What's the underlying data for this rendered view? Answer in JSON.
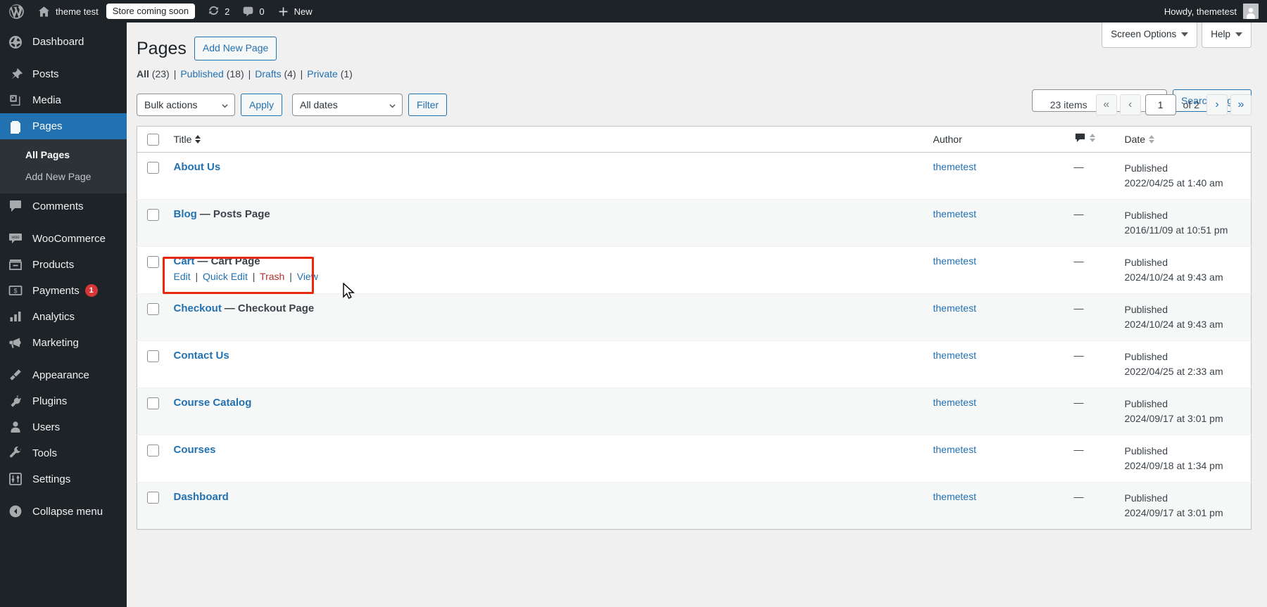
{
  "adminbar": {
    "wp_logo": "wordpress-logo-icon",
    "site_name": "theme test",
    "coming_soon": "Store coming soon",
    "updates_count": "2",
    "comments_count": "0",
    "new_label": "New",
    "howdy": "Howdy, themetest"
  },
  "sidebar": {
    "items": [
      {
        "label": "Dashboard",
        "icon": "dashboard-icon",
        "current": false
      },
      {
        "label": "Posts",
        "icon": "pin-icon",
        "current": false
      },
      {
        "label": "Media",
        "icon": "media-icon",
        "current": false
      },
      {
        "label": "Pages",
        "icon": "pages-icon",
        "current": true
      },
      {
        "label": "Comments",
        "icon": "comment-icon",
        "current": false
      },
      {
        "label": "WooCommerce",
        "icon": "woocommerce-icon",
        "current": false
      },
      {
        "label": "Products",
        "icon": "products-icon",
        "current": false
      },
      {
        "label": "Payments",
        "icon": "payments-icon",
        "current": false,
        "badge": "1"
      },
      {
        "label": "Analytics",
        "icon": "analytics-icon",
        "current": false
      },
      {
        "label": "Marketing",
        "icon": "megaphone-icon",
        "current": false
      },
      {
        "label": "Appearance",
        "icon": "appearance-icon",
        "current": false
      },
      {
        "label": "Plugins",
        "icon": "plugins-icon",
        "current": false
      },
      {
        "label": "Users",
        "icon": "users-icon",
        "current": false
      },
      {
        "label": "Tools",
        "icon": "tools-icon",
        "current": false
      },
      {
        "label": "Settings",
        "icon": "settings-icon",
        "current": false
      }
    ],
    "submenu": [
      {
        "label": "All Pages",
        "current": true
      },
      {
        "label": "Add New Page",
        "current": false
      }
    ],
    "collapse": "Collapse menu"
  },
  "screen_meta": {
    "screen_options": "Screen Options",
    "help": "Help"
  },
  "header": {
    "title": "Pages",
    "add_new": "Add New Page"
  },
  "views": {
    "all": {
      "label": "All",
      "count": "(23)"
    },
    "published": {
      "label": "Published",
      "count": "(18)"
    },
    "drafts": {
      "label": "Drafts",
      "count": "(4)"
    },
    "private": {
      "label": "Private",
      "count": "(1)"
    },
    "separator": "|"
  },
  "search": {
    "value": "",
    "placeholder": "",
    "button": "Search Pages"
  },
  "toolbar": {
    "bulk_actions": "Bulk actions",
    "apply": "Apply",
    "all_dates": "All dates",
    "filter": "Filter"
  },
  "pagination": {
    "items": "23 items",
    "first": "«",
    "prev": "‹",
    "current_page": "1",
    "of_total": "of 2",
    "next": "›",
    "last": "»"
  },
  "table": {
    "columns": {
      "title": "Title",
      "author": "Author",
      "comments": "comment-bubble-icon",
      "date": "Date"
    },
    "rows": [
      {
        "title": "About Us",
        "state": "",
        "author": "themetest",
        "comments": "—",
        "date_status": "Published",
        "date_value": "2022/04/25 at 1:40 am",
        "highlighted": false,
        "actions": []
      },
      {
        "title": "Blog",
        "state": "— Posts Page",
        "author": "themetest",
        "comments": "—",
        "date_status": "Published",
        "date_value": "2016/11/09 at 10:51 pm",
        "highlighted": false,
        "actions": []
      },
      {
        "title": "Cart",
        "state": "— Cart Page",
        "author": "themetest",
        "comments": "—",
        "date_status": "Published",
        "date_value": "2024/10/24 at 9:43 am",
        "highlighted": true,
        "actions": [
          {
            "label": "Edit",
            "kind": "edit"
          },
          {
            "label": "Quick Edit",
            "kind": "quick-edit"
          },
          {
            "label": "Trash",
            "kind": "trash"
          },
          {
            "label": "View",
            "kind": "view"
          }
        ]
      },
      {
        "title": "Checkout",
        "state": "— Checkout Page",
        "author": "themetest",
        "comments": "—",
        "date_status": "Published",
        "date_value": "2024/10/24 at 9:43 am",
        "highlighted": false,
        "actions": []
      },
      {
        "title": "Contact Us",
        "state": "",
        "author": "themetest",
        "comments": "—",
        "date_status": "Published",
        "date_value": "2022/04/25 at 2:33 am",
        "highlighted": false,
        "actions": []
      },
      {
        "title": "Course Catalog",
        "state": "",
        "author": "themetest",
        "comments": "—",
        "date_status": "Published",
        "date_value": "2024/09/17 at 3:01 pm",
        "highlighted": false,
        "actions": []
      },
      {
        "title": "Courses",
        "state": "",
        "author": "themetest",
        "comments": "—",
        "date_status": "Published",
        "date_value": "2024/09/18 at 1:34 pm",
        "highlighted": false,
        "actions": []
      },
      {
        "title": "Dashboard",
        "state": "",
        "author": "themetest",
        "comments": "—",
        "date_status": "Published",
        "date_value": "2024/09/17 at 3:01 pm",
        "highlighted": false,
        "actions": []
      }
    ]
  },
  "colors": {
    "accent": "#2271b1",
    "admin_bg": "#1d2327",
    "highlight": "#e8290b",
    "trash": "#b32d2e",
    "badge": "#d63638"
  }
}
